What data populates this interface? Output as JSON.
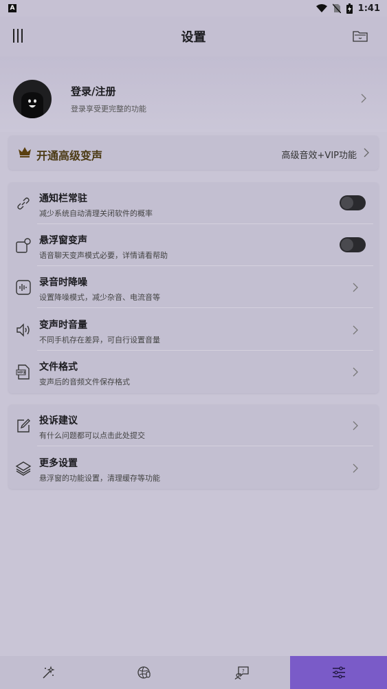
{
  "status_bar": {
    "time": "1:41",
    "app_badge": "A"
  },
  "header": {
    "title": "设置"
  },
  "profile": {
    "name": "登录/注册",
    "subtitle": "登录享受更完整的功能"
  },
  "vip": {
    "label": "开通高级变声",
    "right_text": "高级音效+VIP功能"
  },
  "settings_group1": [
    {
      "title": "通知栏常驻",
      "desc": "减少系统自动清理关闭软件的概率",
      "icon": "link-icon",
      "control": "toggle",
      "on": false
    },
    {
      "title": "悬浮窗变声",
      "desc": "语音聊天变声模式必要，详情请看帮助",
      "icon": "floating-window-icon",
      "control": "toggle",
      "on": false
    },
    {
      "title": "录音时降噪",
      "desc": "设置降噪模式，减少杂音、电流音等",
      "icon": "waveform-icon",
      "control": "chevron"
    },
    {
      "title": "变声时音量",
      "desc": "不同手机存在差异，可自行设置音量",
      "icon": "speaker-icon",
      "control": "chevron"
    },
    {
      "title": "文件格式",
      "desc": "变声后的音频文件保存格式",
      "icon": "mp3-file-icon",
      "control": "chevron"
    }
  ],
  "settings_group2": [
    {
      "title": "投诉建议",
      "desc": "有什么问题都可以点击此处提交",
      "icon": "edit-icon",
      "control": "chevron"
    },
    {
      "title": "更多设置",
      "desc": "悬浮窗的功能设置，清理缓存等功能",
      "icon": "layers-icon",
      "control": "chevron"
    }
  ],
  "tabs": [
    {
      "icon": "magic-wand-icon",
      "active": false
    },
    {
      "icon": "voice-globe-icon",
      "active": false
    },
    {
      "icon": "chat-bubble-icon",
      "active": false
    },
    {
      "icon": "settings-sliders-icon",
      "active": true
    }
  ],
  "colors": {
    "accent": "#7a5bc8",
    "background": "#c9c5d6",
    "card": "#c3bfd1",
    "vip_text": "#4b3a14"
  }
}
